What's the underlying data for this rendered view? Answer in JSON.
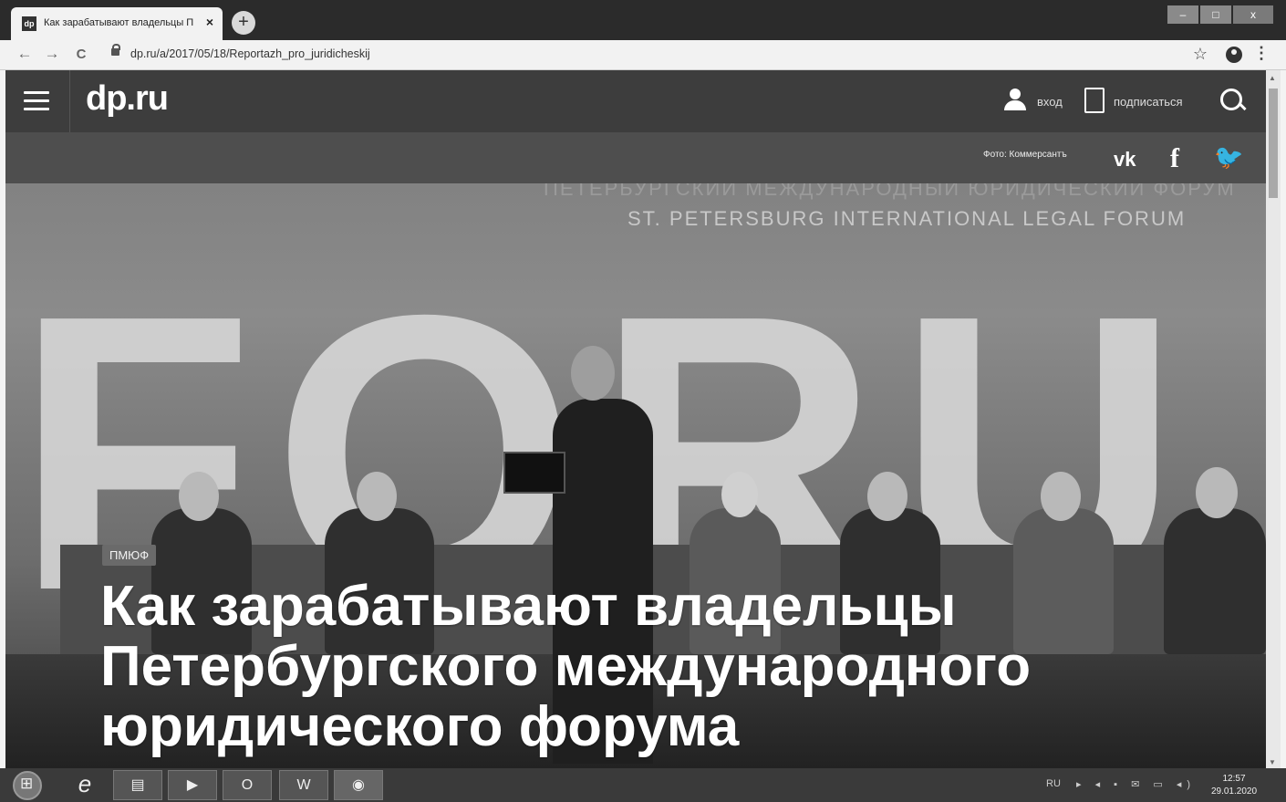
{
  "browser": {
    "tab_title": "Как зарабатывают владельцы П",
    "favicon_label": "dp",
    "tab_close": "×",
    "new_tab": "+",
    "url": "dp.ru/a/2017/05/18/Reportazh_pro_juridicheskij",
    "nav": {
      "back": "←",
      "forward": "→",
      "reload": "C"
    },
    "star": "☆",
    "menu": "⋮",
    "window_controls": {
      "minimize": "–",
      "maximize": "□",
      "close": "x"
    }
  },
  "site": {
    "logo": "dp.ru",
    "login_label": "вход",
    "subscribe_label": "подписаться",
    "photo_credit": "Фото: Коммерсантъ",
    "social": {
      "vk": "vk",
      "facebook": "f",
      "twitter": "🐦"
    }
  },
  "photo": {
    "banner_ru": "ПЕТЕРБУРГСКИЙ МЕЖДУНАРОДНЫЙ ЮРИДИЧЕСКИЙ ФОРУМ",
    "banner_en": "ST. PETERSBURG INTERNATIONAL LEGAL FORUM",
    "big_text": "FORU"
  },
  "article": {
    "tag": "ПМЮФ",
    "headline_lines": [
      "Как зарабатывают владельцы",
      "Петербургского международного",
      "юридического форума"
    ]
  },
  "taskbar": {
    "ie_label": "e",
    "outlook_label": "O",
    "word_label": "W",
    "language": "RU",
    "tray_icons": "▸ ◂ ▪ ✉ ▭ ◂)",
    "time": "12:57",
    "date": "29.01.2020"
  },
  "colors": {
    "header": "#3d3d3d",
    "taskbar": "#3a3a3a"
  }
}
